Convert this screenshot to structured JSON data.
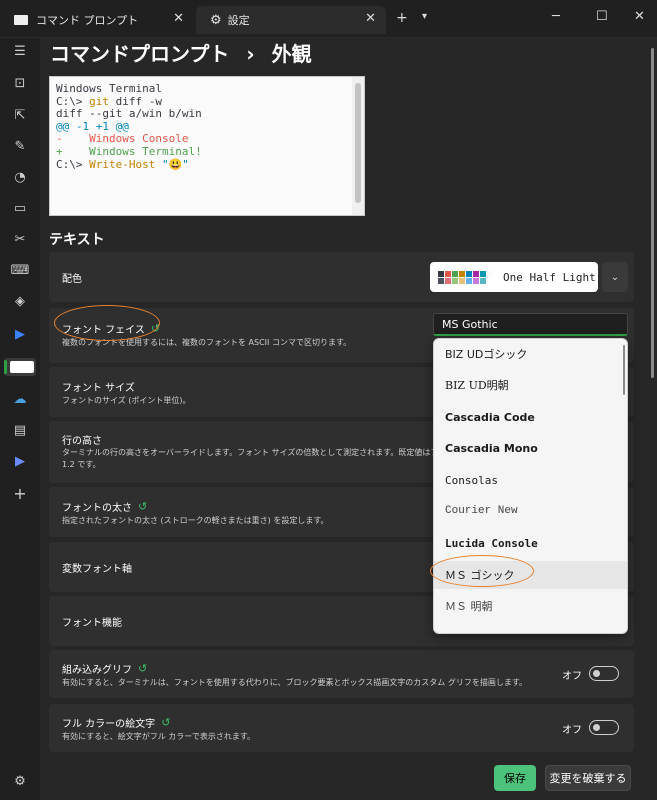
{
  "tabs": [
    {
      "label": "コマンド プロンプト",
      "icon": "terminal-icon"
    },
    {
      "label": "設定",
      "icon": "gear-icon"
    }
  ],
  "window_controls": {
    "minimize": "─",
    "maximize": "☐",
    "close": "✕"
  },
  "breadcrumb": {
    "parent": "コマンドプロンプト",
    "separator": "›",
    "current": "外観"
  },
  "preview_lines": {
    "l1": "Windows Terminal",
    "l2_prompt": "C:\\> ",
    "l2_cmd": "git",
    "l2_rest": " diff -w",
    "l3": "diff --git a/win b/win",
    "l4": "@@ -1 +1 @@",
    "l5_sign": "-",
    "l5_text": "    Windows Console",
    "l6_sign": "+",
    "l6_text": "    Windows Terminal!",
    "l7_prompt": "C:\\> ",
    "l7_cmd": "Write-Host",
    "l7_arg": " \"😃\""
  },
  "section": {
    "title": "テキスト"
  },
  "settings": {
    "color_scheme": {
      "title": "配色",
      "value": "One Half Light"
    },
    "font_face": {
      "title": "フォント フェイス",
      "desc": "複数のフォントを使用するには、複数のフォントを ASCII コンマで区切ります。",
      "value": "MS Gothic"
    },
    "font_size": {
      "title": "フォント サイズ",
      "desc": "フォントのサイズ (ポイント単位)。"
    },
    "line_height": {
      "title": "行の高さ",
      "desc": "ターミナルの行の高さをオーバーライドします。フォント サイズの倍数として測定されます。既定値はフォン",
      "desc2": "1.2 です。"
    },
    "font_weight": {
      "title": "フォントの太さ",
      "desc": "指定されたフォントの太さ (ストロークの軽さまたは重さ) を設定します。"
    },
    "variable_axes": {
      "title": "変数フォント軸"
    },
    "font_features": {
      "title": "フォント機能"
    },
    "builtin_glyphs": {
      "title": "組み込みグリフ",
      "desc": "有効にすると、ターミナルは、フォントを使用する代わりに、ブロック要素とボックス描画文字のカスタム グリフを描画します。",
      "state": "オフ"
    },
    "color_emoji": {
      "title": "フル カラーの絵文字",
      "desc": "有効にすると、絵文字がフル カラーで表示されます。",
      "state": "オフ"
    }
  },
  "font_list": [
    "BIZ UDゴシック",
    "BIZ UD明朝",
    "Cascadia Code",
    "Cascadia Mono",
    "Consolas",
    "Courier New",
    "Lucida Console",
    "ＭＳ ゴシック",
    "ＭＳ 明朝"
  ],
  "swatch_colors": [
    "#383a42",
    "#e45649",
    "#50a14f",
    "#c18401",
    "#0184bc",
    "#a626a4",
    "#0997b3",
    "#fafafa",
    "#4f525e",
    "#e06c75",
    "#98c379",
    "#e5c07b",
    "#61afef",
    "#c678dd",
    "#56b6c2",
    "#ffffff"
  ],
  "footer": {
    "save": "保存",
    "discard": "変更を破棄する"
  },
  "accent": "#2ea043",
  "annotation_color": "#e8822e"
}
